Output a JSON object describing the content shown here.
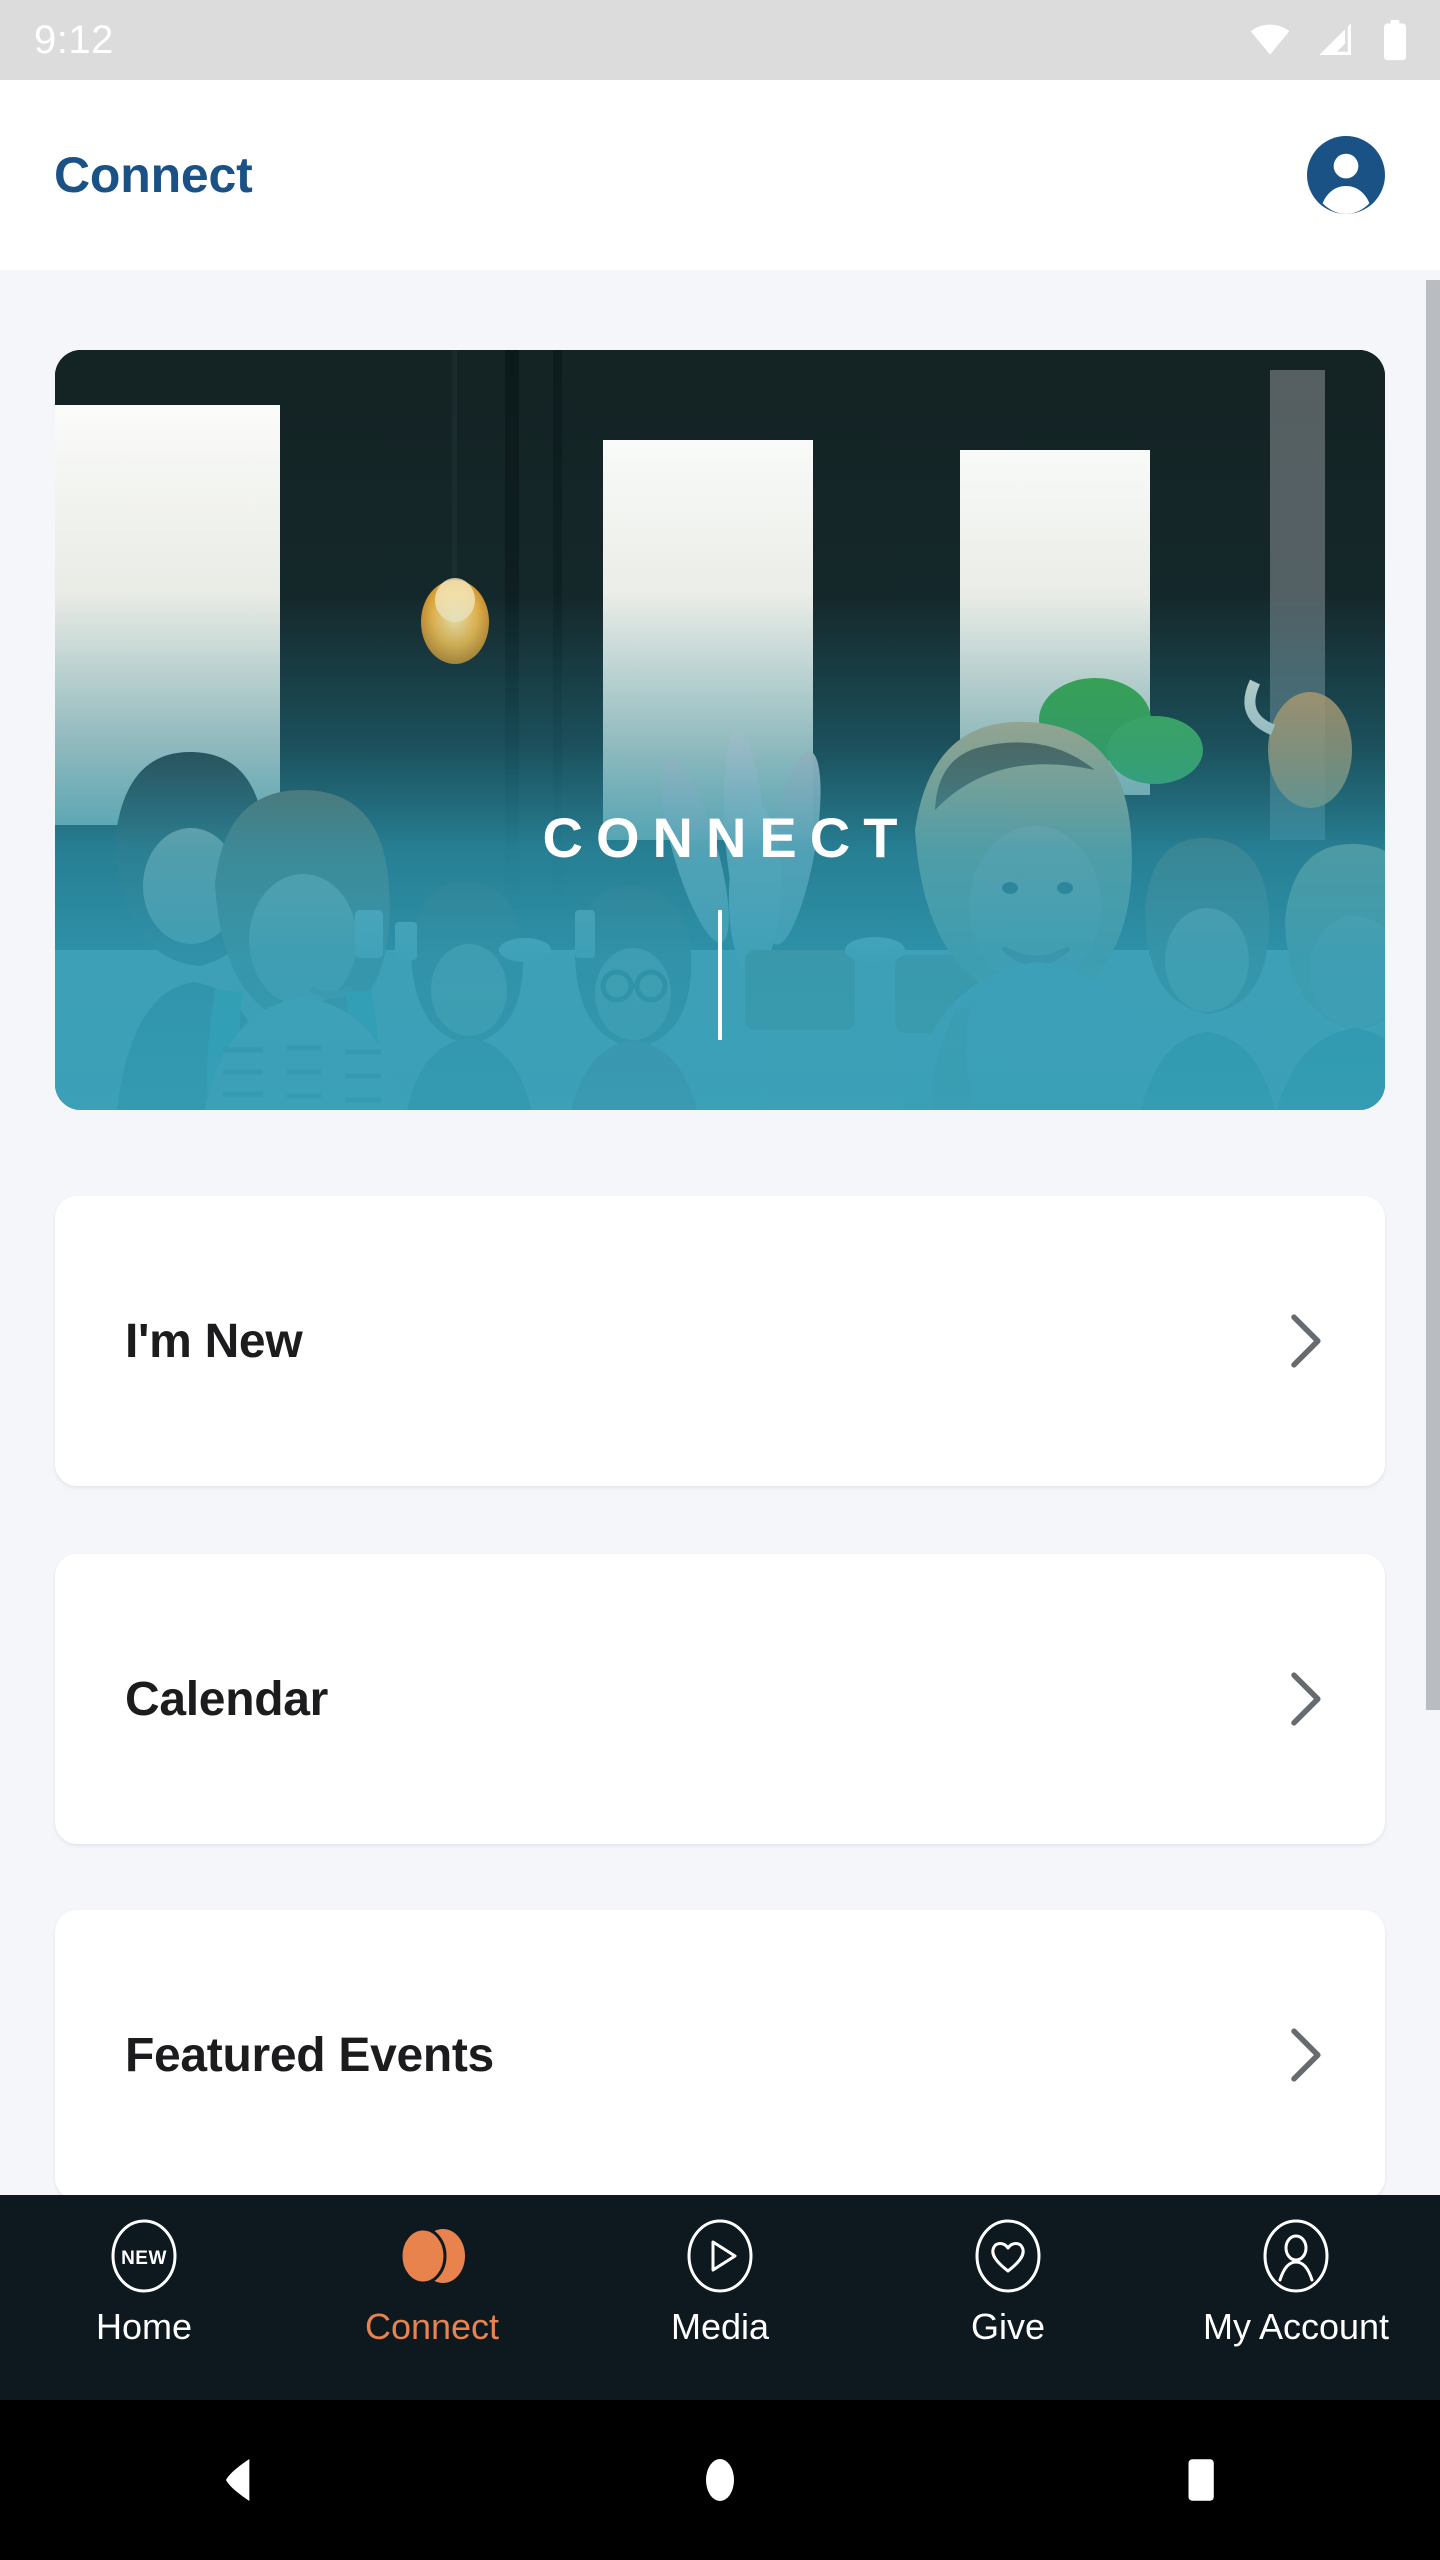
{
  "status_bar": {
    "time": "9:12",
    "icons": [
      "wifi-icon",
      "cellular-signal-icon",
      "battery-icon"
    ],
    "background": "#dcdcdc",
    "foreground": "#ffffff"
  },
  "app_bar": {
    "title": "Connect",
    "title_color": "#1a5286",
    "avatar_icon": "account-avatar-icon",
    "background": "#ffffff"
  },
  "hero": {
    "caption": "CONNECT",
    "overlay_color": "#349eb6",
    "caption_color": "#ffffff",
    "image_description": "group of smiling women seated at a long table in a dark-walled cafe with bright windows"
  },
  "menu": {
    "items": [
      {
        "label": "I'm New",
        "chevron": "chevron-right-icon"
      },
      {
        "label": "Calendar",
        "chevron": "chevron-right-icon"
      },
      {
        "label": "Featured Events",
        "chevron": "chevron-right-icon"
      }
    ]
  },
  "tab_bar": {
    "background": "#0d191f",
    "active_color": "#e8834e",
    "inactive_color": "#ffffff",
    "items": [
      {
        "label": "Home",
        "icon": "new-badge-circle-icon",
        "active": false
      },
      {
        "label": "Connect",
        "icon": "overlapping-circles-icon",
        "active": true
      },
      {
        "label": "Media",
        "icon": "play-circle-icon",
        "active": false
      },
      {
        "label": "Give",
        "icon": "heart-circle-icon",
        "active": false
      },
      {
        "label": "My Account",
        "icon": "person-circle-icon",
        "active": false
      }
    ],
    "home_badge_text": "NEW"
  },
  "system_nav": {
    "background": "#000000",
    "buttons": [
      {
        "name": "back-button",
        "icon": "triangle-left-icon"
      },
      {
        "name": "home-button",
        "icon": "circle-icon"
      },
      {
        "name": "recents-button",
        "icon": "square-icon"
      }
    ]
  },
  "scroll": {
    "thumb_color": "#b9bcc0"
  },
  "page": {
    "background": "#f4f6fa"
  }
}
